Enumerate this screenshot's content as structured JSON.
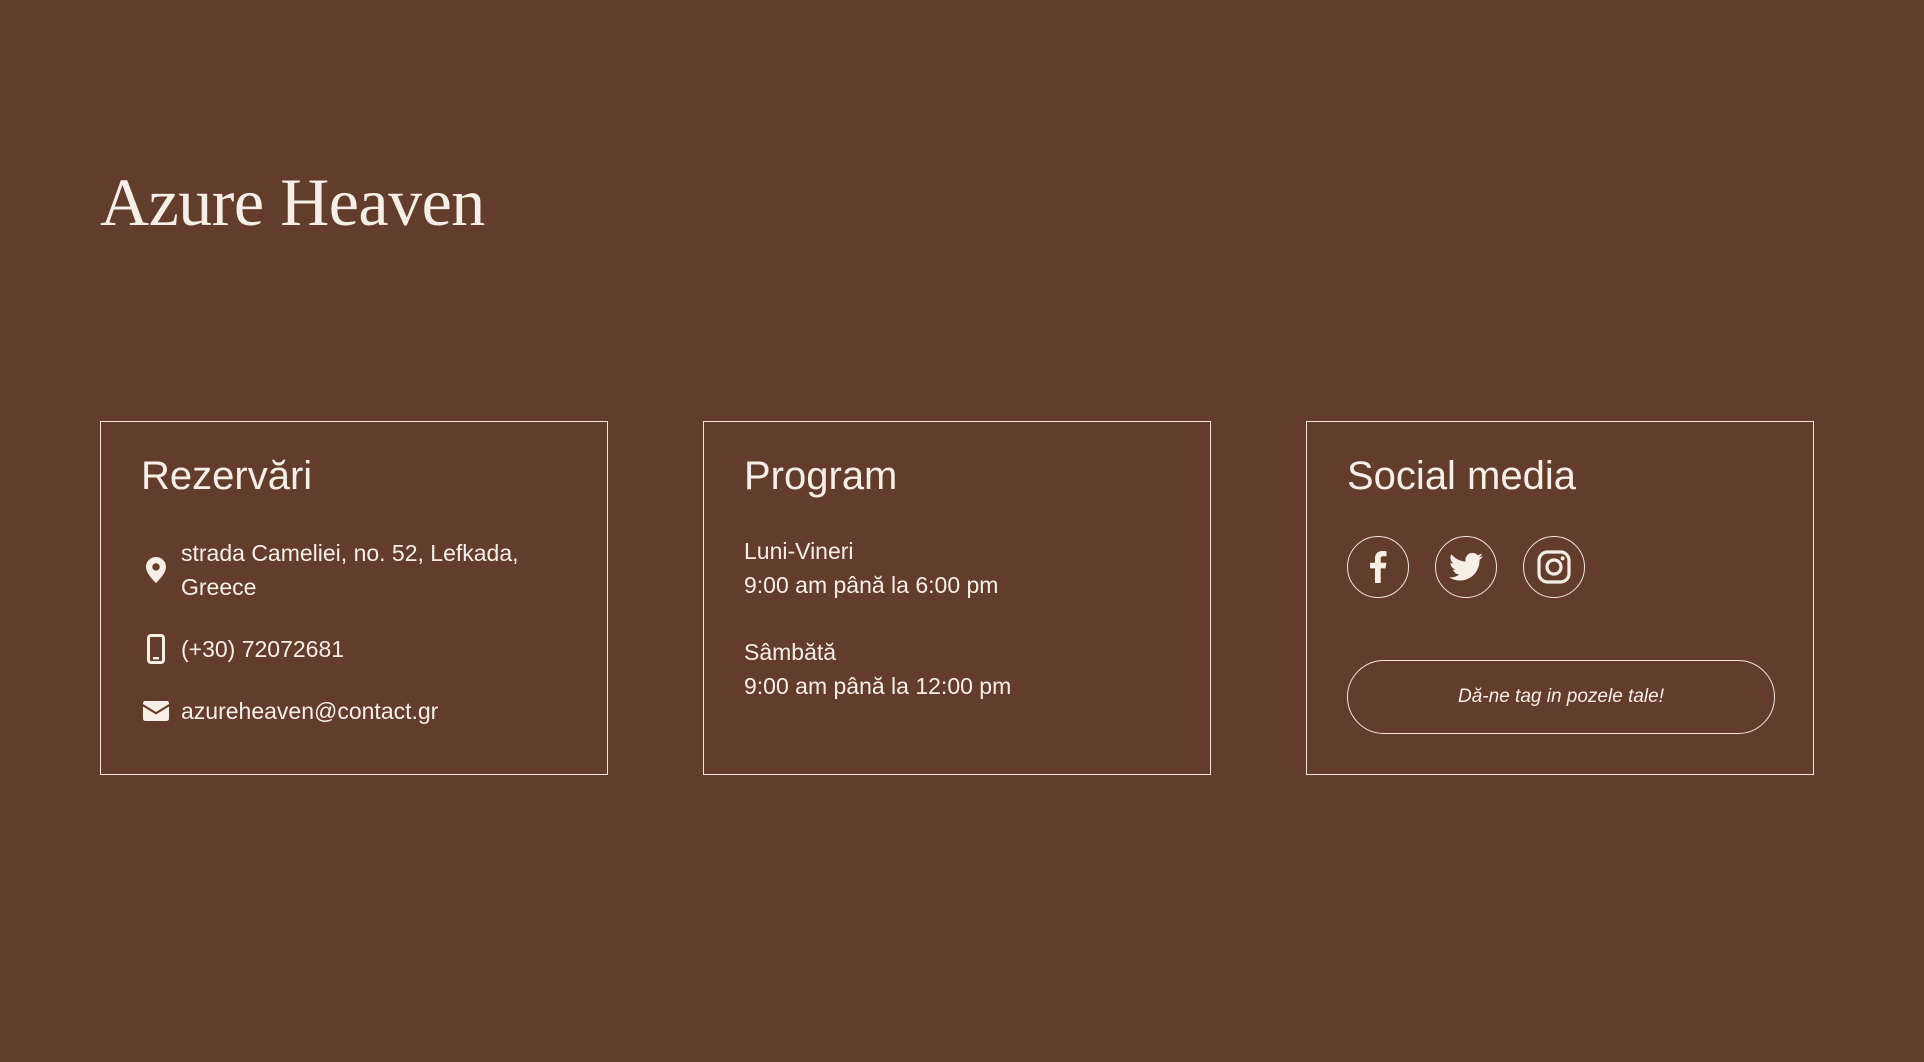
{
  "brand": {
    "title": "Azure Heaven"
  },
  "colors": {
    "background": "#633d2b",
    "text": "#f7efe6",
    "border": "#f2e6da"
  },
  "reservations": {
    "heading": "Rezervări",
    "address": "strada Cameliei, no. 52, Lefkada, Greece",
    "phone": "(+30) 72072681",
    "email": "azureheaven@contact.gr",
    "icons": [
      "map-pin-icon",
      "phone-icon",
      "envelope-icon"
    ]
  },
  "schedule": {
    "heading": "Program",
    "weekdays_label": "Luni-Vineri",
    "weekdays_hours": "9:00 am până la 6:00 pm",
    "saturday_label": "Sâmbătă",
    "saturday_hours": "9:00 am până la 12:00 pm"
  },
  "social": {
    "heading": "Social media",
    "icons": [
      "facebook-icon",
      "twitter-icon",
      "instagram-icon"
    ],
    "tag_button_label": "Dă-ne tag in pozele tale!"
  }
}
